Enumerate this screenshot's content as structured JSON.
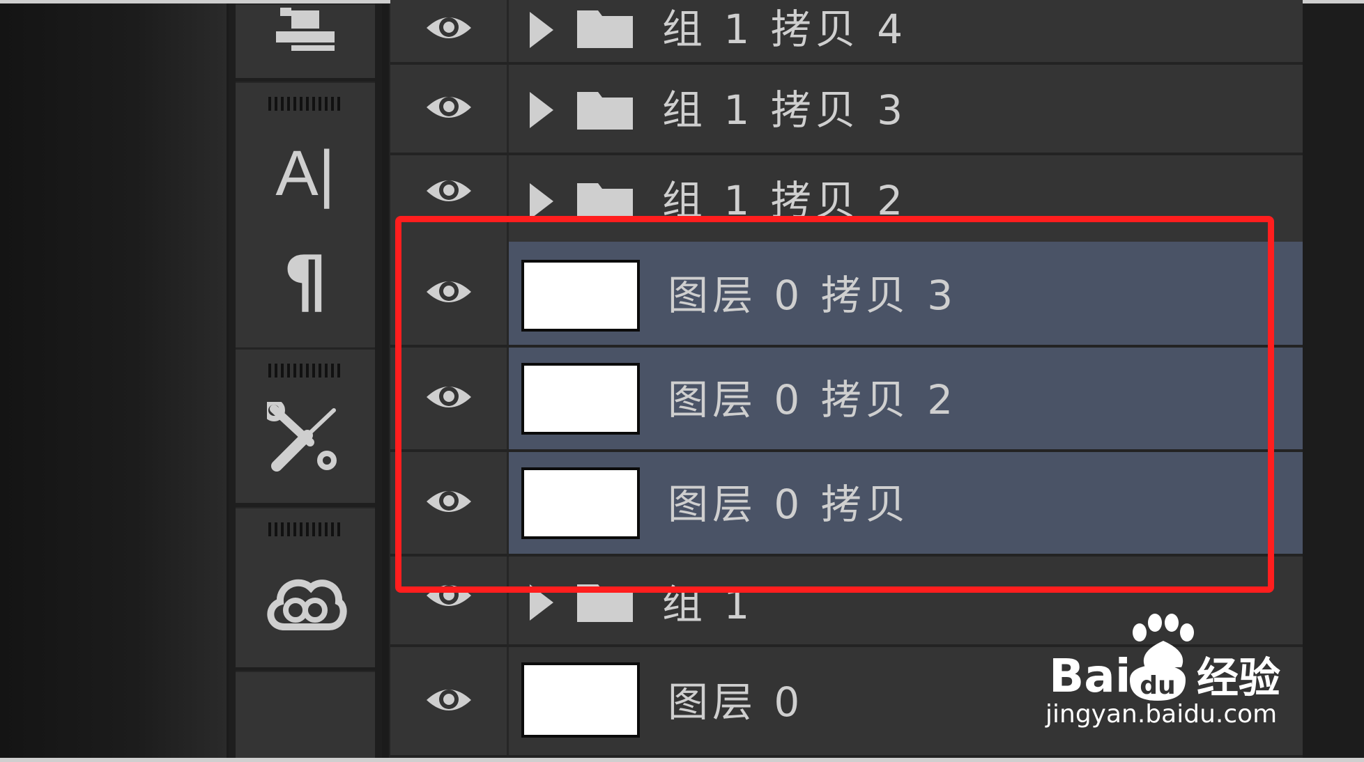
{
  "layers": [
    {
      "type": "group",
      "name": "组 1 拷贝 4",
      "visible": true,
      "selected": false
    },
    {
      "type": "group",
      "name": "组 1 拷贝 3",
      "visible": true,
      "selected": false
    },
    {
      "type": "group",
      "name": "组 1 拷贝 2",
      "visible": true,
      "selected": false
    },
    {
      "type": "layer",
      "name": "图层 0 拷贝 3",
      "visible": true,
      "selected": true
    },
    {
      "type": "layer",
      "name": "图层 0 拷贝 2",
      "visible": true,
      "selected": true
    },
    {
      "type": "layer",
      "name": "图层 0 拷贝",
      "visible": true,
      "selected": true
    },
    {
      "type": "group",
      "name": "组 1",
      "visible": true,
      "selected": false
    },
    {
      "type": "layer",
      "name": "图层 0",
      "visible": true,
      "selected": false
    }
  ],
  "tools": {
    "text_icon_glyph": "A|",
    "paragraph_icon_glyph": "¶"
  },
  "watermark": {
    "brand": "Bai",
    "brand_suffix": "经验",
    "url": "jingyan.baidu.com"
  },
  "colors": {
    "selected_row": "#4a5366",
    "highlight_box": "#ff1e1e",
    "panel": "#343434"
  }
}
